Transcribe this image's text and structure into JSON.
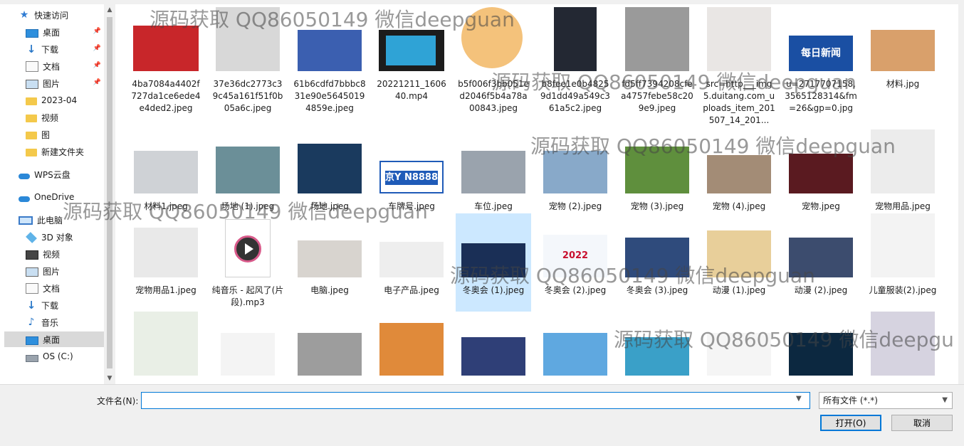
{
  "sidebar": {
    "items": [
      {
        "label": "快速访问",
        "icon": "star-icon"
      },
      {
        "label": "桌面",
        "icon": "desktop-icon",
        "pinned": true
      },
      {
        "label": "下载",
        "icon": "download-icon",
        "pinned": true
      },
      {
        "label": "文档",
        "icon": "document-icon",
        "pinned": true
      },
      {
        "label": "图片",
        "icon": "picture-icon",
        "pinned": true
      },
      {
        "label": "2023-04",
        "icon": "folder-icon"
      },
      {
        "label": "视频",
        "icon": "folder-icon"
      },
      {
        "label": "图",
        "icon": "folder-icon"
      },
      {
        "label": "新建文件夹",
        "icon": "folder-icon"
      },
      {
        "label": "WPS云盘",
        "icon": "cloud-icon"
      },
      {
        "label": "OneDrive",
        "icon": "onedrive-icon"
      },
      {
        "label": "此电脑",
        "icon": "computer-icon"
      },
      {
        "label": "3D 对象",
        "icon": "3d-objects-icon"
      },
      {
        "label": "视频",
        "icon": "video-icon"
      },
      {
        "label": "图片",
        "icon": "picture-icon"
      },
      {
        "label": "文档",
        "icon": "document-icon"
      },
      {
        "label": "下载",
        "icon": "download-icon"
      },
      {
        "label": "音乐",
        "icon": "music-icon"
      },
      {
        "label": "桌面",
        "icon": "desktop-icon",
        "selected": true
      },
      {
        "label": "OS (C:)",
        "icon": "drive-icon"
      }
    ]
  },
  "files": [
    {
      "name": "4ba7084a4402f727da1ce6ede4e4ded2.jpeg"
    },
    {
      "name": "37e36dc2773c39c45a161f51f0b05a6c.jpeg"
    },
    {
      "name": "61b6cdfd7bbbc831e90e56450194859e.jpeg"
    },
    {
      "name": "20221211_160640.mp4"
    },
    {
      "name": "b5f006f3bb051ed2046f5b4a78a00843.jpeg"
    },
    {
      "name": "b8fee1e0b48259d1dd49a549c361a5c2.jpeg"
    },
    {
      "name": "fd5ff7394208cfea4757febe58c209e9.jpeg"
    },
    {
      "name": "src=http___img5.duitang.com_uploads_item_201507_14_201..."
    },
    {
      "name": "u=2717707158,3565128314&fm=26&gp=0.jpg"
    },
    {
      "name": "材料.jpg"
    },
    {
      "name": "材料1.jpeg"
    },
    {
      "name": "场地 (1).jpeg"
    },
    {
      "name": "场地.jpeg"
    },
    {
      "name": "车牌号.jpeg"
    },
    {
      "name": "车位.jpeg"
    },
    {
      "name": "宠物 (2).jpeg"
    },
    {
      "name": "宠物 (3).jpeg"
    },
    {
      "name": "宠物 (4).jpeg"
    },
    {
      "name": "宠物.jpeg"
    },
    {
      "name": "宠物用品.jpeg"
    },
    {
      "name": "宠物用品1.jpeg"
    },
    {
      "name": "纯音乐 - 起风了(片段).mp3"
    },
    {
      "name": "电脑.jpeg"
    },
    {
      "name": "电子产品.jpeg"
    },
    {
      "name": "冬奥会 (1).jpeg",
      "selected": true
    },
    {
      "name": "冬奥会 (2).jpeg"
    },
    {
      "name": "冬奥会 (3).jpeg"
    },
    {
      "name": "动漫 (1).jpeg"
    },
    {
      "name": "动漫 (2).jpeg"
    },
    {
      "name": "儿童服装(2).jpeg"
    },
    {
      "name": ""
    },
    {
      "name": ""
    },
    {
      "name": ""
    },
    {
      "name": ""
    },
    {
      "name": ""
    },
    {
      "name": ""
    },
    {
      "name": ""
    },
    {
      "name": ""
    },
    {
      "name": ""
    },
    {
      "name": ""
    }
  ],
  "thumb_text": {
    "plate": "京Y N8888",
    "news": "每日新闻",
    "olympic": "2022"
  },
  "bottom": {
    "filename_label": "文件名(N):",
    "filename_value": "",
    "filetype_value": "所有文件 (*.*)",
    "open_label": "打开(O)",
    "cancel_label": "取消"
  },
  "watermarks": [
    "源码获取 QQ86050149 微信deepguan",
    "源码获取 QQ86050149 微信deepguan",
    "源码获取 QQ86050149 微信deepguan",
    "源码获取 QQ86050149 微信deepguan",
    "源码获取 QQ86050149 微信deepguan",
    "源码获取 QQ86050149 微信deepgu"
  ],
  "colors": {
    "accent": "#0078d7",
    "selection": "#cce8ff",
    "nav_selected": "#d9d9d9"
  }
}
